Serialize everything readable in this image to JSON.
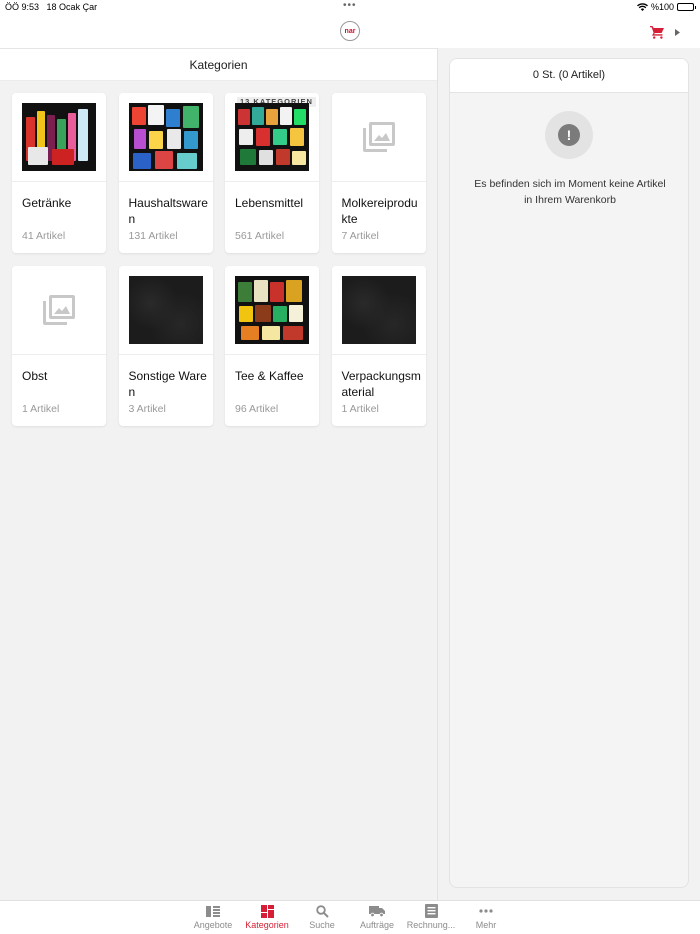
{
  "status_bar": {
    "time": "ÖÖ 9:53",
    "date": "18 Ocak Çar",
    "battery": "%100",
    "battery_level": 1.0,
    "multitask_dots": "•••"
  },
  "navbar": {
    "logo_text": "nar",
    "cart_icon": "shopping-cart-icon",
    "chevron_icon": "chevron-right-icon"
  },
  "categories_header": "Kategorien",
  "categories": [
    {
      "name": "Getränke",
      "count": "41 Artikel",
      "image": "drinks",
      "badge": ""
    },
    {
      "name": "Haushaltswaren",
      "count": "131 Artikel",
      "image": "household",
      "badge": ""
    },
    {
      "name": "Lebensmittel",
      "count": "561 Artikel",
      "image": "groceries",
      "badge": "13 KATEGORIEN"
    },
    {
      "name": "Molkereiprodukte",
      "count": "7 Artikel",
      "image": "placeholder",
      "badge": ""
    },
    {
      "name": "Obst",
      "count": "1 Artikel",
      "image": "placeholder",
      "badge": ""
    },
    {
      "name": "Sonstige Waren",
      "count": "3 Artikel",
      "image": "dark",
      "badge": ""
    },
    {
      "name": "Tee & Kaffee",
      "count": "96 Artikel",
      "image": "tea",
      "badge": ""
    },
    {
      "name": "Verpackungsmaterial",
      "count": "1 Artikel",
      "image": "dark",
      "badge": ""
    }
  ],
  "cart": {
    "header": "0 St. (0 Artikel)",
    "empty_message": "Es befinden sich im Moment keine Artikel in Ihrem Warenkorb",
    "empty_icon_glyph": "!"
  },
  "tabs": [
    {
      "label": "Angebote",
      "icon": "offers-icon",
      "active": false
    },
    {
      "label": "Kategorien",
      "icon": "categories-icon",
      "active": true
    },
    {
      "label": "Suche",
      "icon": "search-icon",
      "active": false
    },
    {
      "label": "Aufträge",
      "icon": "truck-icon",
      "active": false
    },
    {
      "label": "Rechnung...",
      "icon": "invoice-icon",
      "active": false
    },
    {
      "label": "Mehr",
      "icon": "more-icon",
      "active": false
    }
  ],
  "colors": {
    "accent": "#d61f36",
    "inactive": "#8c8c8c"
  }
}
